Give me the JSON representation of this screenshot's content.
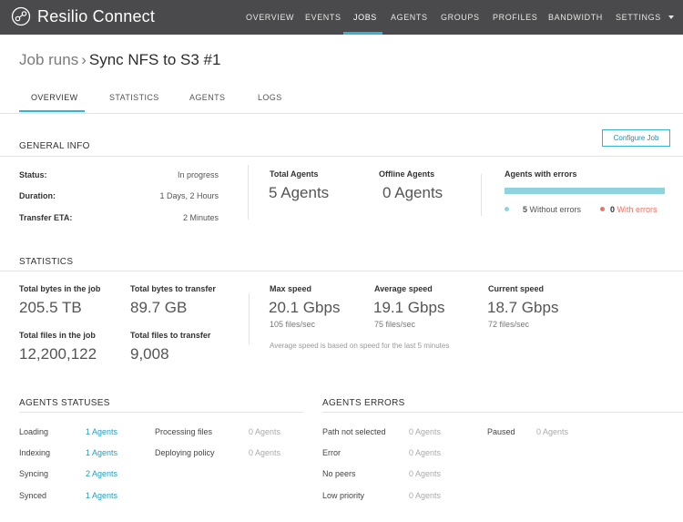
{
  "app": {
    "brand_part1": "Resilio",
    "brand_part2": "Connect",
    "logo_icon": "resilio-logo-icon"
  },
  "nav": {
    "overview": "OVERVIEW",
    "events": "EVENTS",
    "jobs": "JOBS",
    "agents": "AGENTS",
    "groups": "GROUPS",
    "profiles": "PROFILES",
    "bandwidth": "BANDWIDTH",
    "settings": "SETTINGS",
    "active": "JOBS"
  },
  "breadcrumb": {
    "parent": "Job runs",
    "separator": "›",
    "current": "Sync NFS to S3 #1"
  },
  "tabs": {
    "overview": "OVERVIEW",
    "statistics": "STATISTICS",
    "agents": "AGENTS",
    "logs": "LOGS",
    "active": "OVERVIEW"
  },
  "general_info": {
    "title": "GENERAL INFO",
    "configure_button": "Configure Job",
    "status_label": "Status:",
    "status_value": "In progress",
    "duration_label": "Duration:",
    "duration_value": "1 Days, 2 Hours",
    "eta_label": "Transfer ETA:",
    "eta_value": "2 Minutes",
    "total_agents_label": "Total Agents",
    "total_agents_value": "5 Agents",
    "offline_agents_label": "Offline Agents",
    "offline_agents_value": "0 Agents",
    "agents_errors_label": "Agents with errors",
    "without_errors_count": "5",
    "without_errors_label": "Without errors",
    "with_errors_count": "0",
    "with_errors_label": "With errors"
  },
  "statistics": {
    "title": "STATISTICS",
    "total_bytes_label": "Total bytes in the job",
    "total_bytes_value": "205.5 TB",
    "bytes_to_transfer_label": "Total bytes to transfer",
    "bytes_to_transfer_value": "89.7 GB",
    "total_files_label": "Total files in the job",
    "total_files_value": "12,200,122",
    "files_to_transfer_label": "Total files to transfer",
    "files_to_transfer_value": "9,008",
    "max_speed_label": "Max speed",
    "max_speed_value": "20.1 Gbps",
    "max_speed_files": "105 files/sec",
    "avg_speed_label": "Average speed",
    "avg_speed_value": "19.1 Gbps",
    "avg_speed_files": "75 files/sec",
    "cur_speed_label": "Current speed",
    "cur_speed_value": "18.7 Gbps",
    "cur_speed_files": "72 files/sec",
    "note": "Average speed is based on speed for the last 5 minutes"
  },
  "agent_statuses": {
    "title": "AGENTS STATUSES",
    "rows": [
      {
        "label": "Loading",
        "value": "1 Agents"
      },
      {
        "label": "Indexing",
        "value": "1 Agents"
      },
      {
        "label": "Syncing",
        "value": "2 Agents"
      },
      {
        "label": "Synced",
        "value": "1 Agents"
      },
      {
        "label": "Processing files",
        "value": "0 Agents"
      },
      {
        "label": "Deploying policy",
        "value": "0 Agents"
      }
    ]
  },
  "agent_errors": {
    "title": "AGENTS ERRORS",
    "rows": [
      {
        "label": "Path not selected",
        "value": "0 Agents"
      },
      {
        "label": "Error",
        "value": "0 Agents"
      },
      {
        "label": "No peers",
        "value": "0 Agents"
      },
      {
        "label": "Low priority",
        "value": "0 Agents"
      },
      {
        "label": "Paused",
        "value": "0 Agents"
      }
    ]
  },
  "colors": {
    "accent": "#34b3d4",
    "topbar": "#4a4a4c",
    "error_red": "#e8746a",
    "ok_teal": "#8fd3df"
  }
}
